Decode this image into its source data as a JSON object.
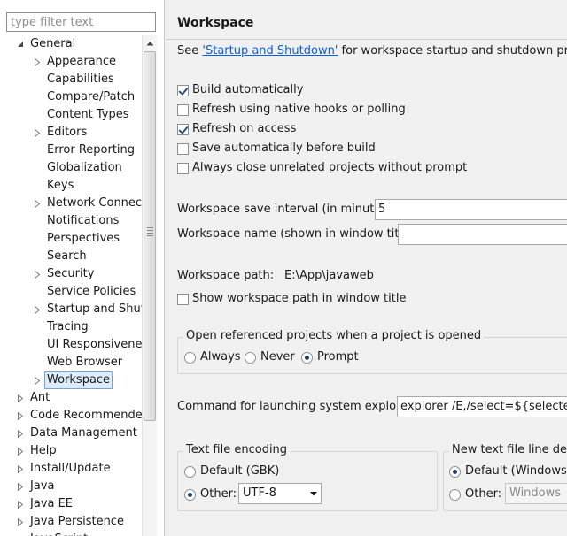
{
  "sidebar": {
    "filter_placeholder": "type filter text",
    "tree": [
      {
        "label": "General",
        "level": 0,
        "state": "expanded"
      },
      {
        "label": "Appearance",
        "level": 1,
        "state": "collapsed"
      },
      {
        "label": "Capabilities",
        "level": 1,
        "state": "leaf"
      },
      {
        "label": "Compare/Patch",
        "level": 1,
        "state": "leaf"
      },
      {
        "label": "Content Types",
        "level": 1,
        "state": "leaf"
      },
      {
        "label": "Editors",
        "level": 1,
        "state": "collapsed"
      },
      {
        "label": "Error Reporting",
        "level": 1,
        "state": "leaf"
      },
      {
        "label": "Globalization",
        "level": 1,
        "state": "leaf"
      },
      {
        "label": "Keys",
        "level": 1,
        "state": "leaf"
      },
      {
        "label": "Network Connections",
        "level": 1,
        "state": "collapsed"
      },
      {
        "label": "Notifications",
        "level": 1,
        "state": "leaf"
      },
      {
        "label": "Perspectives",
        "level": 1,
        "state": "leaf"
      },
      {
        "label": "Search",
        "level": 1,
        "state": "leaf"
      },
      {
        "label": "Security",
        "level": 1,
        "state": "collapsed"
      },
      {
        "label": "Service Policies",
        "level": 1,
        "state": "leaf"
      },
      {
        "label": "Startup and Shutdown",
        "level": 1,
        "state": "collapsed"
      },
      {
        "label": "Tracing",
        "level": 1,
        "state": "leaf"
      },
      {
        "label": "UI Responsiveness",
        "level": 1,
        "state": "leaf"
      },
      {
        "label": "Web Browser",
        "level": 1,
        "state": "leaf"
      },
      {
        "label": "Workspace",
        "level": 1,
        "state": "collapsed",
        "selected": true
      },
      {
        "label": "Ant",
        "level": 0,
        "state": "collapsed"
      },
      {
        "label": "Code Recommenders",
        "level": 0,
        "state": "collapsed"
      },
      {
        "label": "Data Management",
        "level": 0,
        "state": "collapsed"
      },
      {
        "label": "Help",
        "level": 0,
        "state": "collapsed"
      },
      {
        "label": "Install/Update",
        "level": 0,
        "state": "collapsed"
      },
      {
        "label": "Java",
        "level": 0,
        "state": "collapsed"
      },
      {
        "label": "Java EE",
        "level": 0,
        "state": "collapsed"
      },
      {
        "label": "Java Persistence",
        "level": 0,
        "state": "collapsed"
      },
      {
        "label": "JavaScript",
        "level": 0,
        "state": "collapsed"
      }
    ]
  },
  "page": {
    "title": "Workspace",
    "intro_prefix": "See ",
    "intro_link": "'Startup and Shutdown'",
    "intro_suffix": " for workspace startup and shutdown preferences.",
    "checkboxes": [
      {
        "label": "Build automatically",
        "checked": true
      },
      {
        "label": "Refresh using native hooks or polling",
        "checked": false
      },
      {
        "label": "Refresh on access",
        "checked": true
      },
      {
        "label": "Save automatically before build",
        "checked": false
      },
      {
        "label": "Always close unrelated projects without prompt",
        "checked": false
      }
    ],
    "save_interval_label": "Workspace save interval (in minutes):",
    "save_interval_value": "5",
    "name_label": "Workspace name (shown in window title):",
    "name_value": "",
    "path_label": "Workspace path:",
    "path_value": "E:\\App\\javaweb",
    "show_path_label": "Show workspace path in window title",
    "show_path_checked": false,
    "open_group": {
      "title": "Open referenced projects when a project is opened",
      "options": [
        "Always",
        "Never",
        "Prompt"
      ],
      "selected": "Prompt"
    },
    "explorer_label": "Command for launching system explorer:",
    "explorer_value": "explorer /E,/select=${selected_resource_loc}",
    "encoding_group": {
      "title": "Text file encoding",
      "default_label": "Default (GBK)",
      "other_label": "Other:",
      "selected": "Other",
      "other_value": "UTF-8"
    },
    "line_delim_group": {
      "title": "New text file line delimiter",
      "default_label": "Default (Windows)",
      "other_label": "Other:",
      "selected": "Default",
      "other_value": "Windows"
    }
  }
}
